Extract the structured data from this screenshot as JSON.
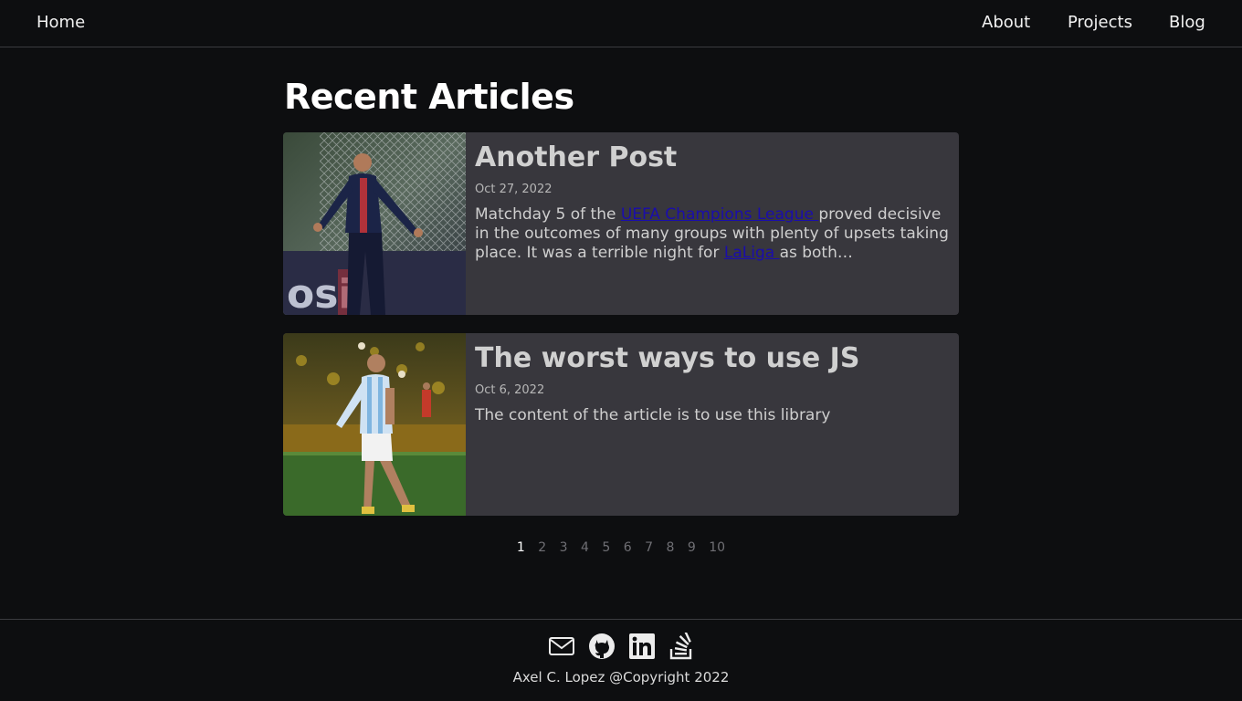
{
  "nav": {
    "home": "Home",
    "about": "About",
    "projects": "Projects",
    "blog": "Blog"
  },
  "main": {
    "title": "Recent Articles",
    "articles": [
      {
        "title": "Another Post",
        "date": "Oct 27, 2022",
        "excerpt_parts": [
          "Matchday 5 of the ",
          "UEFA Champions League ",
          "proved decisive in the outcomes of many groups with plenty of upsets taking place. It was a terrible night for ",
          "LaLiga ",
          "as both…"
        ],
        "image_alt": "Soccer player in dark blue kit celebrating in front of goal net"
      },
      {
        "title": "The worst ways to use JS",
        "date": "Oct 6, 2022",
        "excerpt": "The content of the article is to use this library",
        "image_alt": "Soccer player in light blue and white striped kit kicking a ball"
      }
    ]
  },
  "pagination": {
    "pages": [
      "1",
      "2",
      "3",
      "4",
      "5",
      "6",
      "7",
      "8",
      "9",
      "10"
    ],
    "current": "1"
  },
  "footer": {
    "icons": [
      "mail-icon",
      "github-icon",
      "linkedin-icon",
      "stackoverflow-icon"
    ],
    "copyright": "Axel C. Lopez @Copyright 2022"
  },
  "colors": {
    "background": "#0d0e10",
    "card": "#38373d",
    "link": "#1a0dab"
  }
}
